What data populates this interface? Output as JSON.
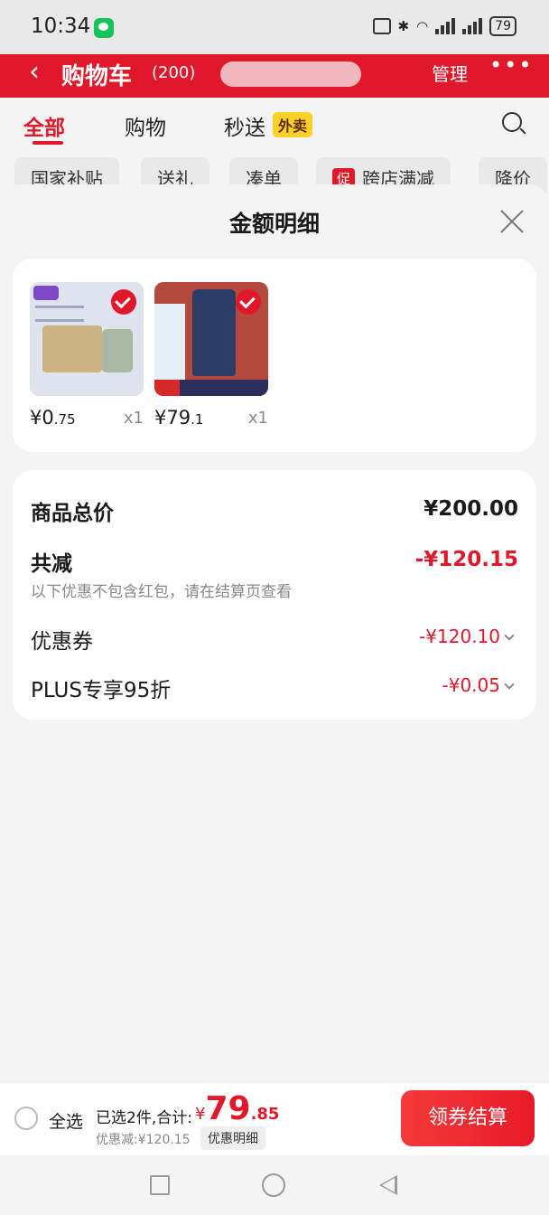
{
  "status_bar": {
    "time": "10:34",
    "battery": "79"
  },
  "cart_header": {
    "back": "‹",
    "title": "购物车",
    "count": "(200)",
    "manage": "管理",
    "more": "•••"
  },
  "tabs": [
    {
      "label": "全部"
    },
    {
      "label": "购物"
    },
    {
      "label": "秒送"
    }
  ],
  "tab_badge": "外卖",
  "chips": [
    "国家补贴",
    "送礼",
    "凑单",
    "跨店满减",
    "降价"
  ],
  "promo_tag": "促",
  "sheet": {
    "title": "金额明细",
    "products": [
      {
        "price_int": "¥0",
        "price_dec": ".75",
        "qty": "x1"
      },
      {
        "price_int": "¥79",
        "price_dec": ".1",
        "qty": "x1"
      }
    ],
    "summary": {
      "total_label": "商品总价",
      "total_value": "¥200.00",
      "reduction_label": "共减",
      "reduction_value": "-¥120.15",
      "note": "以下优惠不包含红包，请在结算页查看",
      "coupon_label": "优惠券",
      "coupon_value": "-¥120.10",
      "plus_label": "PLUS专享95折",
      "plus_value": "-¥0.05"
    }
  },
  "bottom_bar": {
    "select_all": "全选",
    "selected_text": "已选2件,合计:",
    "total_currency": "¥",
    "total_int": "79",
    "total_dec": ".85",
    "discount_text": "优惠减:¥120.15",
    "detail_button": "优惠明细",
    "checkout_button": "领券结算"
  },
  "colors": {
    "accent": "#e0182a",
    "badge_yellow": "#ffd028"
  }
}
